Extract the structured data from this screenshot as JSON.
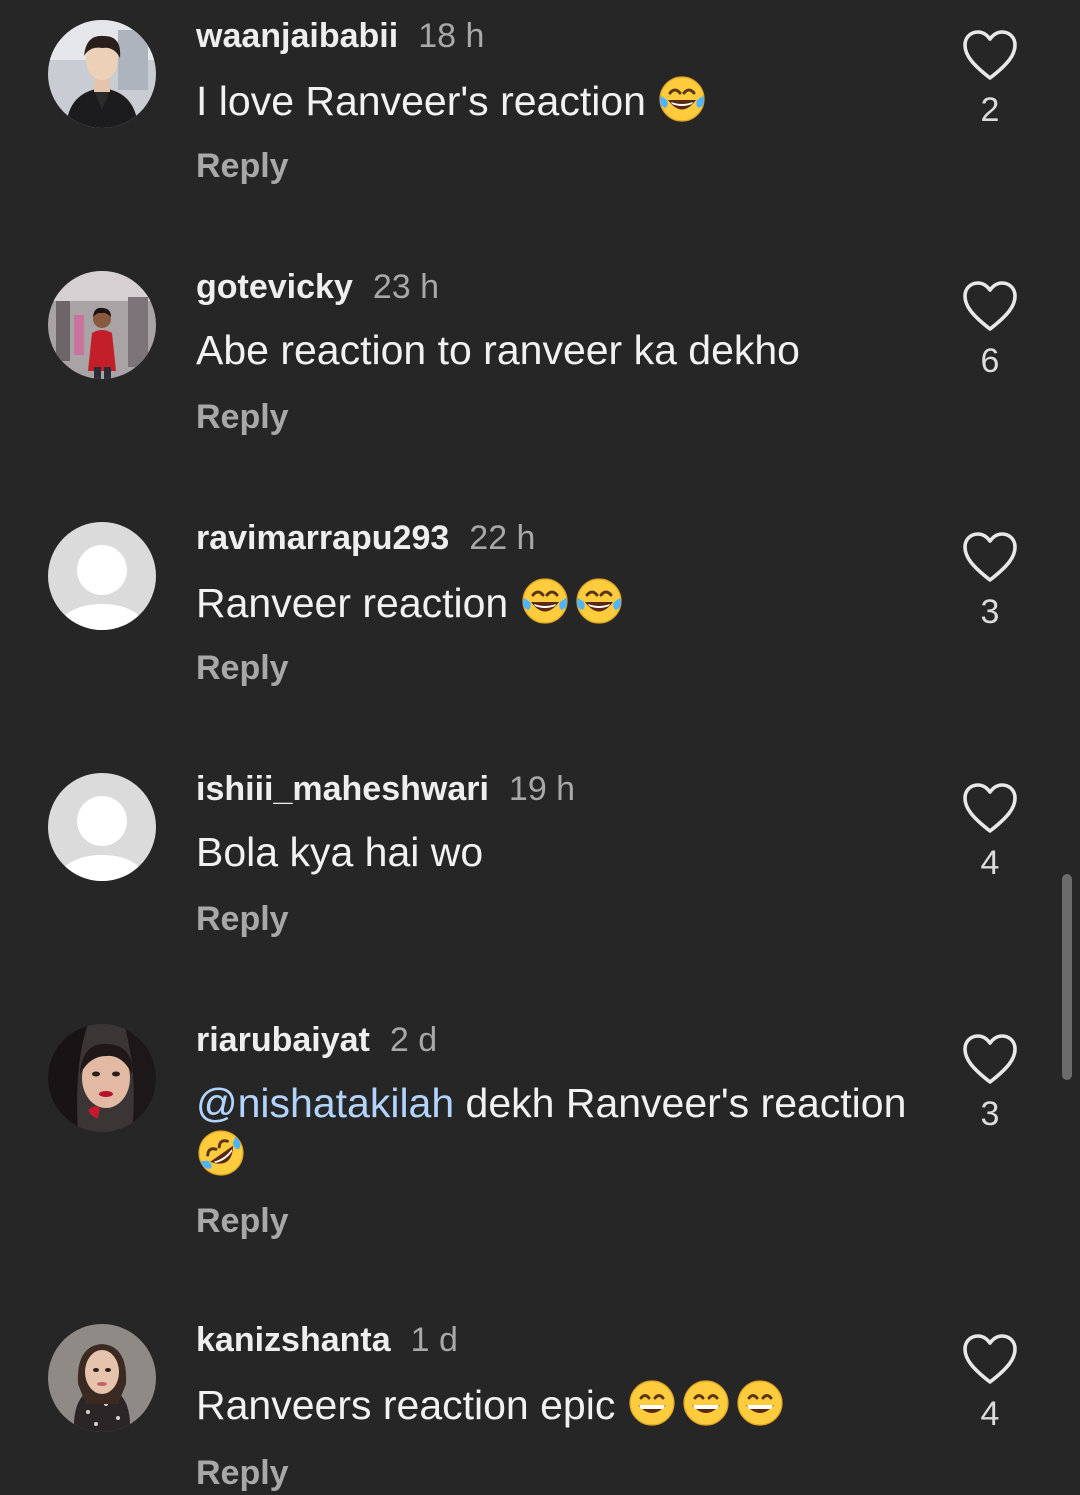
{
  "comments": [
    {
      "username": "waanjaibabii",
      "time": "18 h",
      "text": "I love Ranveer's reaction",
      "mention": "",
      "emojis": [
        "joy"
      ],
      "emoji_wrap": false,
      "likes": "2",
      "reply_label": "Reply",
      "avatar": "photo-man-dark-jacket"
    },
    {
      "username": "gotevicky",
      "time": "23 h",
      "text": "Abe reaction to ranveer ka dekho",
      "mention": "",
      "emojis": [],
      "emoji_wrap": false,
      "likes": "6",
      "reply_label": "Reply",
      "avatar": "photo-man-red-shirt-gym"
    },
    {
      "username": "ravimarrapu293",
      "time": "22 h",
      "text": "Ranveer reaction",
      "mention": "",
      "emojis": [
        "joy",
        "joy"
      ],
      "emoji_wrap": false,
      "likes": "3",
      "reply_label": "Reply",
      "avatar": "default"
    },
    {
      "username": "ishiii_maheshwari",
      "time": "19 h",
      "text": "Bola kya hai wo",
      "mention": "",
      "emojis": [],
      "emoji_wrap": false,
      "likes": "4",
      "reply_label": "Reply",
      "avatar": "default"
    },
    {
      "username": "riarubaiyat",
      "time": "2 d",
      "text": " dekh Ranveer's reaction",
      "mention": "@nishatakilah",
      "emojis": [
        "rofl"
      ],
      "emoji_wrap": true,
      "likes": "3",
      "reply_label": "Reply",
      "avatar": "photo-woman-red-lips"
    },
    {
      "username": "kanizshanta",
      "time": "1 d",
      "text": "Ranveers reaction epic",
      "mention": "",
      "emojis": [
        "grin",
        "grin",
        "grin"
      ],
      "emoji_wrap": false,
      "likes": "4",
      "reply_label": "Reply",
      "avatar": "photo-woman-sparkle-top"
    }
  ],
  "colors": {
    "background": "#262626",
    "text_primary": "#f1f1f1",
    "text_secondary": "#a8a8a8",
    "mention": "#b3d4ff",
    "scrollbar": "#6b6b6b"
  },
  "icons": {
    "like": "heart-outline-icon"
  }
}
